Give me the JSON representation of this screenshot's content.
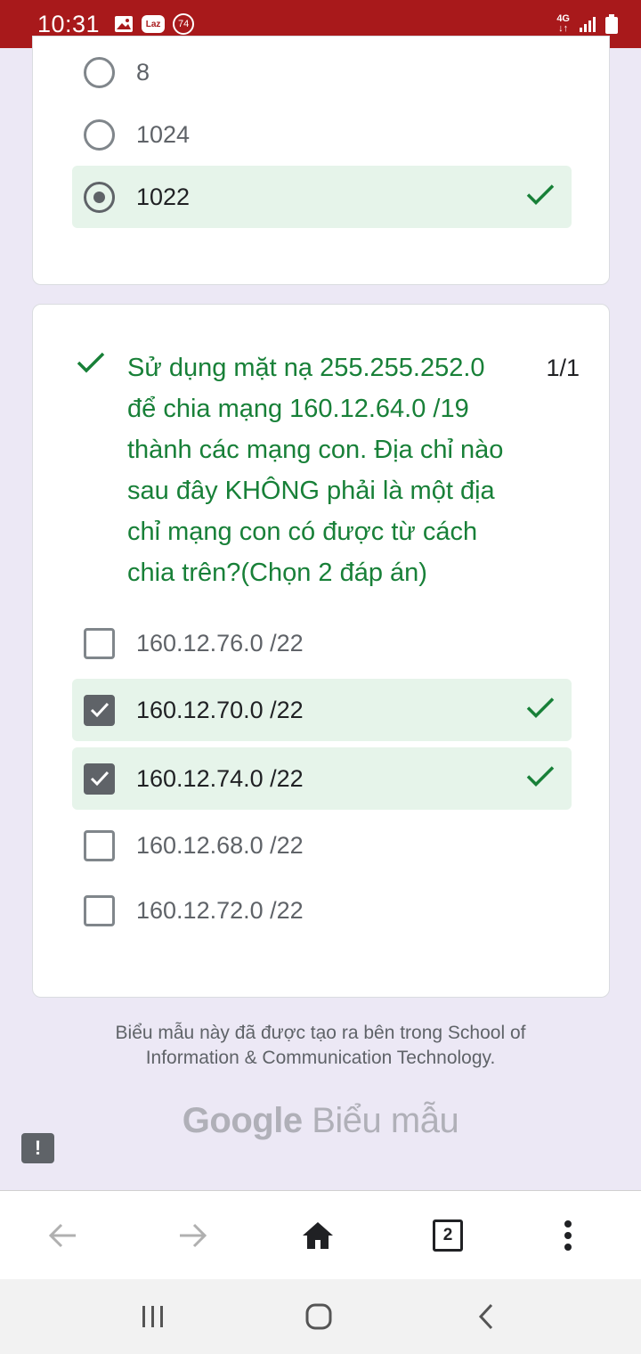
{
  "status_bar": {
    "time": "10:31",
    "notification_icons": [
      "gallery-icon",
      "lazada-icon",
      "badge-74-icon"
    ],
    "badge_count": "74",
    "lazada_label": "Laz",
    "network": "4G"
  },
  "previous_question": {
    "options": [
      {
        "label": "8",
        "selected": false,
        "correct": false
      },
      {
        "label": "1024",
        "selected": false,
        "correct": false
      },
      {
        "label": "1022",
        "selected": true,
        "correct": true
      }
    ]
  },
  "question": {
    "text": "Sử dụng mặt nạ 255.255.252.0 để chia mạng 160.12.64.0 /19 thành các mạng con. Địa chỉ nào sau đây KHÔNG phải là một địa chỉ mạng con có được từ cách chia trên?(Chọn 2 đáp án)",
    "score": "1/1",
    "options": [
      {
        "label": "160.12.76.0 /22",
        "checked": false,
        "correct": false
      },
      {
        "label": "160.12.70.0 /22",
        "checked": true,
        "correct": true
      },
      {
        "label": "160.12.74.0 /22",
        "checked": true,
        "correct": true
      },
      {
        "label": "160.12.68.0 /22",
        "checked": false,
        "correct": false
      },
      {
        "label": "160.12.72.0 /22",
        "checked": false,
        "correct": false
      }
    ]
  },
  "footer": {
    "text": "Biểu mẫu này đã được tạo ra bên trong School of Information & Communication Technology.",
    "brand_google": "Google",
    "brand_forms": "Biểu mẫu",
    "feedback_label": "!"
  },
  "browser_bar": {
    "tab_count": "2"
  },
  "colors": {
    "status_bar": "#a8191b",
    "correct_green": "#188038",
    "correct_bg": "#e6f4ea",
    "page_bg": "#ece8f5"
  }
}
